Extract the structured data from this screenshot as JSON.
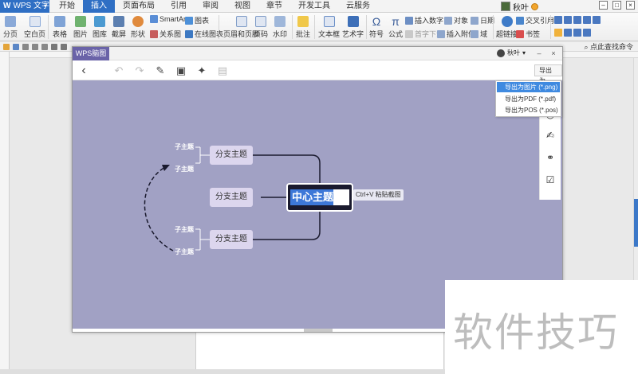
{
  "app": {
    "name": "WPS 文字"
  },
  "menu": [
    "开始",
    "插入",
    "页面布局",
    "引用",
    "审阅",
    "视图",
    "章节",
    "开发工具",
    "云服务"
  ],
  "menu_active_index": 1,
  "user": {
    "name": "秋叶"
  },
  "ribbon": {
    "page_break": "分页",
    "blank_page": "空白页",
    "table": "表格",
    "picture": "图片",
    "gallery": "图库",
    "screenshot": "截屏",
    "shapes": "形状",
    "smartart": "SmartArt",
    "chart": "图表",
    "relation": "关系图",
    "online_chart": "在线图表",
    "header_footer": "页眉和页脚",
    "page_number": "页码",
    "watermark": "水印",
    "comment": "批注",
    "textbox": "文本框",
    "wordart": "艺术字",
    "symbol": "符号",
    "formula": "公式",
    "insert_number": "插入数字",
    "object": "对象",
    "date": "日期",
    "first_letter": "首字下沉",
    "attachment": "插入附件",
    "field": "域",
    "hyperlink": "超链接",
    "bookmark": "书签",
    "cross_ref": "交叉引用"
  },
  "quick_access": {
    "assistant": "点此查找命令"
  },
  "dialog": {
    "title": "WPS脑图",
    "user": "秋叶",
    "export_label": "导出为",
    "export_menu": [
      "导出为图片 (*.png)",
      "导出为PDF (*.pdf)",
      "导出为POS (*.pos)"
    ],
    "export_selected_index": 0
  },
  "mindmap": {
    "center": "中心主题",
    "paste_hint": "Ctrl+V 粘贴截图",
    "branches": [
      "分支主题",
      "分支主题",
      "分支主题"
    ],
    "subtopics": [
      "子主题",
      "子主题",
      "子主题",
      "子主题"
    ]
  },
  "watermark": {
    "text": "软件技巧"
  },
  "colors": {
    "canvas": "#a1a1c4",
    "accent": "#2f6fc4",
    "dialog_tab": "#6a63a8",
    "selection": "#3f8ae0"
  }
}
